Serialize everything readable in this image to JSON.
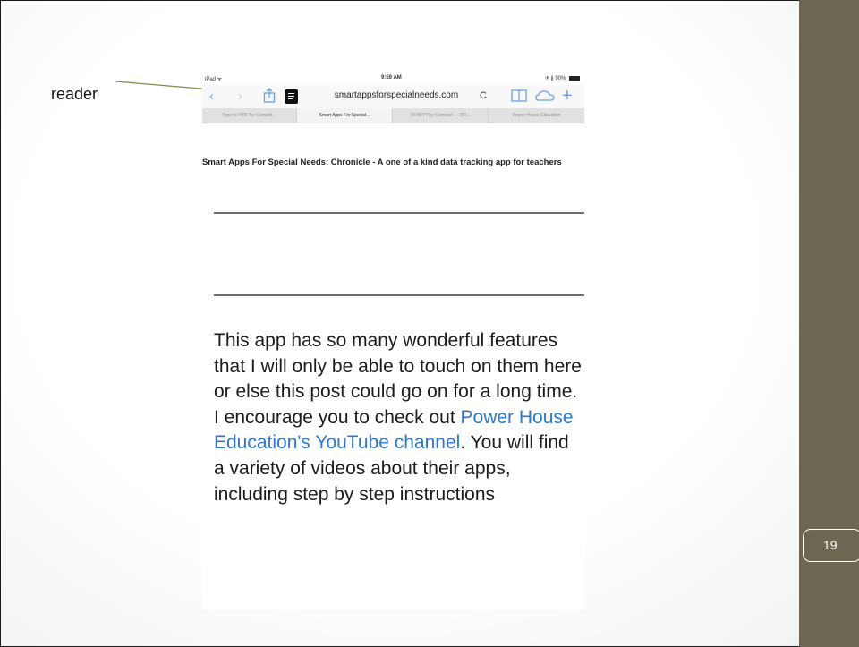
{
  "slide": {
    "annotation_label": "reader",
    "page_number": "19"
  },
  "ipad": {
    "status": {
      "carrier": "iPad ᯤ",
      "time": "9:59 AM",
      "battery": "✈ ∦ 90%"
    },
    "url": "smartappsforspecialneeds.com",
    "tabs": [
      "Type on PDF for Complet...",
      "Smart Apps For Special...",
      "XFINITY by Comcast — OR...",
      "Power House Education"
    ],
    "article": {
      "title": "Smart Apps For Special Needs: Chronicle - A one of a kind data tracking app for teachers",
      "body_before": "This app has so many wonderful features that I will only be able to touch on them here or else this post could go on for a long time. I encourage you to check out ",
      "link": "Power House Education's YouTube channel",
      "body_after": ". You will find a variety of videos about their apps, including step by step instructions"
    }
  },
  "colors": {
    "accent_band": "#6d6651",
    "link": "#2e77c7",
    "safari_tint": "#6aa0e4"
  }
}
